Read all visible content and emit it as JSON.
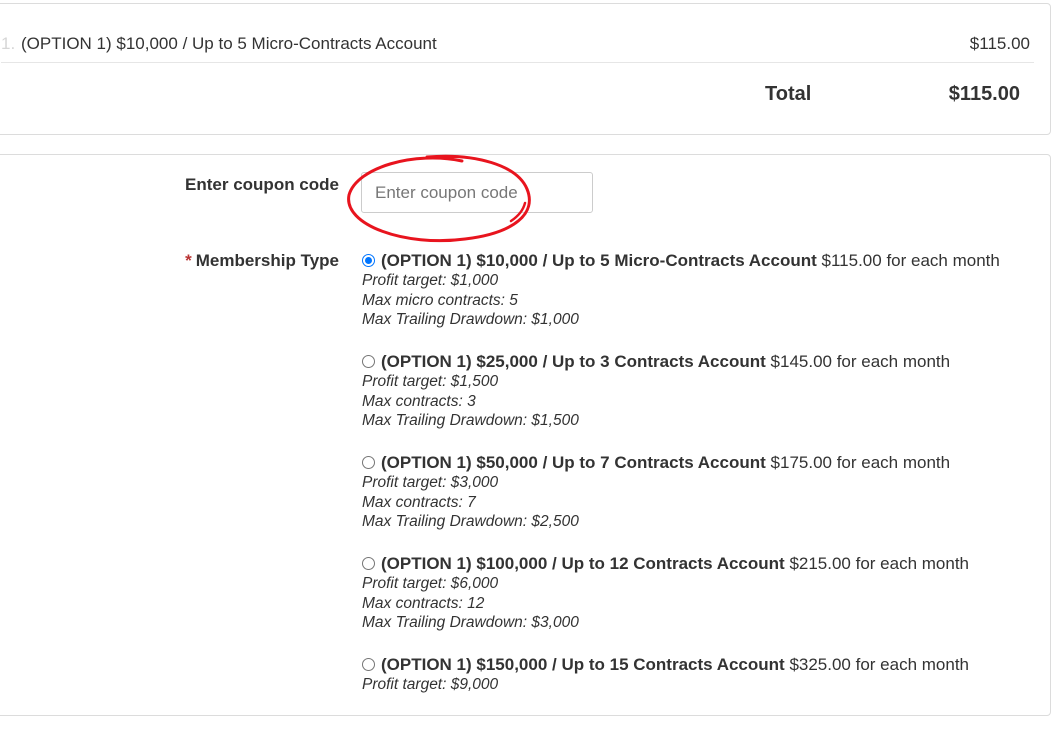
{
  "summary": {
    "line_number": "1.",
    "item_name": "(OPTION 1) $10,000 / Up to 5 Micro-Contracts Account",
    "item_price": "$115.00",
    "total_label": "Total",
    "total_value": "$115.00"
  },
  "coupon": {
    "label": "Enter coupon code",
    "placeholder": "Enter coupon code",
    "value": "",
    "highlight_color": "#e8141e"
  },
  "membership": {
    "required_mark": "*",
    "label": "Membership Type",
    "options": [
      {
        "name": "(OPTION 1) $10,000 / Up to 5 Micro-Contracts Account",
        "price": "$115.00 for each month",
        "selected": true,
        "details": [
          "Profit target: $1,000",
          "Max micro contracts: 5",
          "Max Trailing Drawdown: $1,000"
        ]
      },
      {
        "name": "(OPTION 1) $25,000 / Up to 3 Contracts Account",
        "price": "$145.00 for each month",
        "selected": false,
        "details": [
          "Profit target: $1,500",
          "Max contracts: 3",
          "Max Trailing Drawdown: $1,500"
        ]
      },
      {
        "name": "(OPTION 1) $50,000 / Up to 7 Contracts Account",
        "price": "$175.00 for each month",
        "selected": false,
        "details": [
          "Profit target: $3,000",
          "Max contracts: 7",
          "Max Trailing Drawdown: $2,500"
        ]
      },
      {
        "name": "(OPTION 1) $100,000 / Up to 12 Contracts Account",
        "price": "$215.00 for each month",
        "selected": false,
        "details": [
          "Profit target: $6,000",
          "Max contracts: 12",
          "Max Trailing Drawdown: $3,000"
        ]
      },
      {
        "name": "(OPTION 1) $150,000 / Up to 15 Contracts Account",
        "price": "$325.00 for each month",
        "selected": false,
        "details": [
          "Profit target: $9,000"
        ]
      }
    ]
  }
}
